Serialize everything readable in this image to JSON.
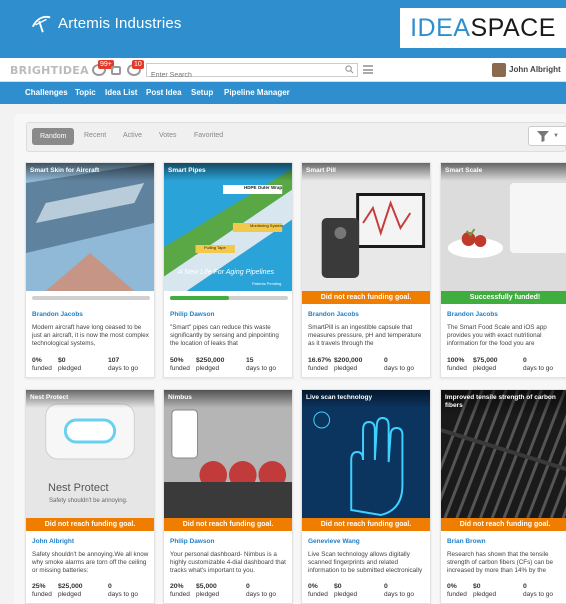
{
  "banner": {
    "company": "Artemis Industries",
    "brand_part1": "IDEA",
    "brand_part2": "SPACE",
    "brand_color": "#2f8fce"
  },
  "toolbar": {
    "logo_text": "BRIGHTIDEA",
    "badge_a": "99+",
    "badge_b": "10",
    "search_placeholder": "Enter Search",
    "user_name": "John Albright",
    "icons": [
      "notifications-icon",
      "messages-icon",
      "alerts-icon",
      "search-icon",
      "list-view-icon",
      "filter-icon"
    ]
  },
  "nav": {
    "items": [
      "Challenges",
      "Topic",
      "Idea List",
      "Post Idea",
      "Setup",
      "Pipeline Manager"
    ]
  },
  "sort": {
    "tabs": [
      "Random",
      "Recent",
      "Active",
      "Votes",
      "Favorited"
    ],
    "active": "Random"
  },
  "labels": {
    "funded": "funded",
    "pledged": "pledged",
    "days_to_go": "days to go"
  },
  "cards": [
    {
      "title": "Smart Skin for Aircraft",
      "author": "Brandon Jacobs",
      "description": "Modern aircraft have long ceased to be just an aircraft, it is now the most complex technological systems,",
      "funded": "0%",
      "pledged": "$0",
      "days": "107",
      "status": "",
      "progress": 0,
      "overlay_text": [],
      "palette": [
        "#8fb9d6",
        "#d88a6a",
        "#4a6b86"
      ]
    },
    {
      "title": "Smart Pipes",
      "author": "Philip Dawson",
      "description": "\"Smart\" pipes can reduce this waste significantly by sensing and pinpointing the location of leaks that",
      "funded": "50%",
      "pledged": "$250,000",
      "days": "15",
      "status": "",
      "progress": 0.5,
      "overlay_text": [
        "HDPE Outer Wrap",
        "Monitoring System",
        "Pulling Tape",
        "A New Life For Aging Pipelines",
        "Patents Pending"
      ],
      "palette": [
        "#2aa3d8",
        "#f2c94c",
        "#5aa845"
      ]
    },
    {
      "title": "Smart Pill",
      "author": "Brandon Jacobs",
      "description": "SmartPill is an ingestible capsule that measures pressure, pH and temperature as it travels through the",
      "funded": "16.67%",
      "pledged": "$200,000",
      "days": "0",
      "status": "Did not reach funding goal.",
      "status_type": "fail",
      "progress": 0.1667,
      "overlay_text": [],
      "palette": [
        "#e8e8e8",
        "#3a3a3a",
        "#c83b3b"
      ]
    },
    {
      "title": "Smart Scale",
      "author": "Brandon Jacobs",
      "description": "The Smart Food Scale and iOS app provides you with exact nutritional information for the food you are",
      "funded": "100%",
      "pledged": "$75,000",
      "days": "0",
      "status": "Successfully funded!",
      "status_type": "ok",
      "progress": 1,
      "overlay_text": [],
      "palette": [
        "#dcdcdc",
        "#c0392b",
        "#6f9e3a"
      ]
    },
    {
      "title": "Nest Protect",
      "author": "John Albright",
      "description": "Safety shouldn't be annoying.We all know why smoke alarms are torn off the ceiling or missing batteries:",
      "funded": "25%",
      "pledged": "$25,000",
      "days": "0",
      "status": "Did not reach funding goal.",
      "status_type": "fail",
      "progress": 0.25,
      "overlay_text": [
        "Nest Protect",
        "Safety shouldn't be annoying."
      ],
      "palette": [
        "#e6e6e6",
        "#5f5f5f",
        "#6ad0f0"
      ]
    },
    {
      "title": "Nimbus",
      "author": "Philip Dawson",
      "description": "Your personal dashboard- Nimbus is a highly customizable 4-dial dashboard that tracks what's important to you.",
      "funded": "20%",
      "pledged": "$5,000",
      "days": "0",
      "status": "Did not reach funding goal.",
      "status_type": "fail",
      "progress": 0.2,
      "overlay_text": [],
      "palette": [
        "#b5b5b5",
        "#c23b3b",
        "#3a3a3a"
      ]
    },
    {
      "title": "Live scan technology",
      "author": "Genevieve Wang",
      "description": "Live Scan technology allows digitally scanned fingerprints and related information to be submitted electronically",
      "funded": "0%",
      "pledged": "$0",
      "days": "0",
      "status": "Did not reach funding goal.",
      "status_type": "fail",
      "progress": 0,
      "overlay_text": [],
      "palette": [
        "#0b3d6e",
        "#3fd0ff",
        "#0a1f3d"
      ]
    },
    {
      "title": "Improved tensile strength of carbon fibers",
      "author": "Brian Brown",
      "description": "Research has shown that the tensile strength of carbon fibers (CFs) can be increased by more than 14% by the",
      "funded": "0%",
      "pledged": "$0",
      "days": "0",
      "status": "Did not reach funding goal.",
      "status_type": "fail",
      "progress": 0,
      "overlay_text": [],
      "palette": [
        "#1a1a1a",
        "#6f6f6f",
        "#3a3a3a"
      ]
    }
  ]
}
